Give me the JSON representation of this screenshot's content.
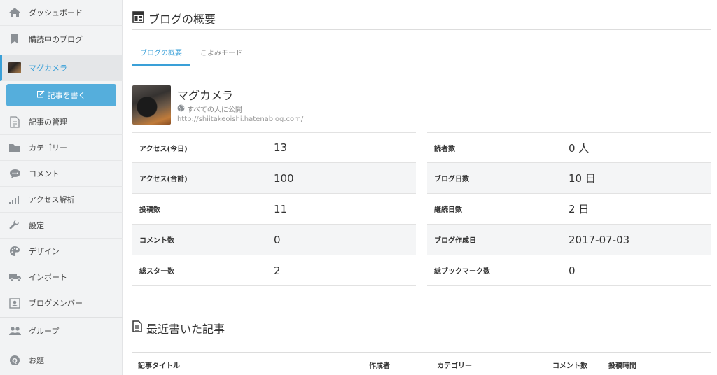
{
  "sidebar": {
    "items": [
      {
        "label": "ダッシュボード",
        "icon": "home-icon"
      },
      {
        "label": "購読中のブログ",
        "icon": "bookmark-icon"
      },
      {
        "label": "マグカメラ",
        "icon": "blog-thumbnail-icon"
      },
      {
        "label": "記事の管理",
        "icon": "document-icon"
      },
      {
        "label": "カテゴリー",
        "icon": "folder-icon"
      },
      {
        "label": "コメント",
        "icon": "comment-icon"
      },
      {
        "label": "アクセス解析",
        "icon": "bar-chart-icon"
      },
      {
        "label": "設定",
        "icon": "wrench-icon"
      },
      {
        "label": "デザイン",
        "icon": "palette-icon"
      },
      {
        "label": "インポート",
        "icon": "truck-icon"
      },
      {
        "label": "ブログメンバー",
        "icon": "member-card-icon"
      },
      {
        "label": "グループ",
        "icon": "users-icon"
      },
      {
        "label": "お題",
        "icon": "theme-q-icon"
      }
    ],
    "write_button": "記事を書く"
  },
  "page": {
    "title": "ブログの概要",
    "tabs": [
      "ブログの概要",
      "こよみモード"
    ]
  },
  "blog": {
    "name": "マグカメラ",
    "visibility": "すべての人に公開",
    "url": "http://shiitakeoishi.hatenablog.com/"
  },
  "stats_left": [
    {
      "label": "アクセス(今日)",
      "value": "13"
    },
    {
      "label": "アクセス(合計)",
      "value": "100"
    },
    {
      "label": "投稿数",
      "value": "11"
    },
    {
      "label": "コメント数",
      "value": "0"
    },
    {
      "label": "総スター数",
      "value": "2"
    }
  ],
  "stats_right": [
    {
      "label": "読者数",
      "value": "0 人"
    },
    {
      "label": "ブログ日数",
      "value": "10 日"
    },
    {
      "label": "継続日数",
      "value": "2 日"
    },
    {
      "label": "ブログ作成日",
      "value": "2017-07-03"
    },
    {
      "label": "総ブックマーク数",
      "value": "0"
    }
  ],
  "recent": {
    "title": "最近書いた記事",
    "columns": [
      "記事タイトル",
      "作成者",
      "カテゴリー",
      "コメント数",
      "投稿時間"
    ]
  },
  "colors": {
    "accent": "#3aa0d8",
    "button": "#55aedc",
    "sidebar_bg": "#f2f3f4"
  }
}
